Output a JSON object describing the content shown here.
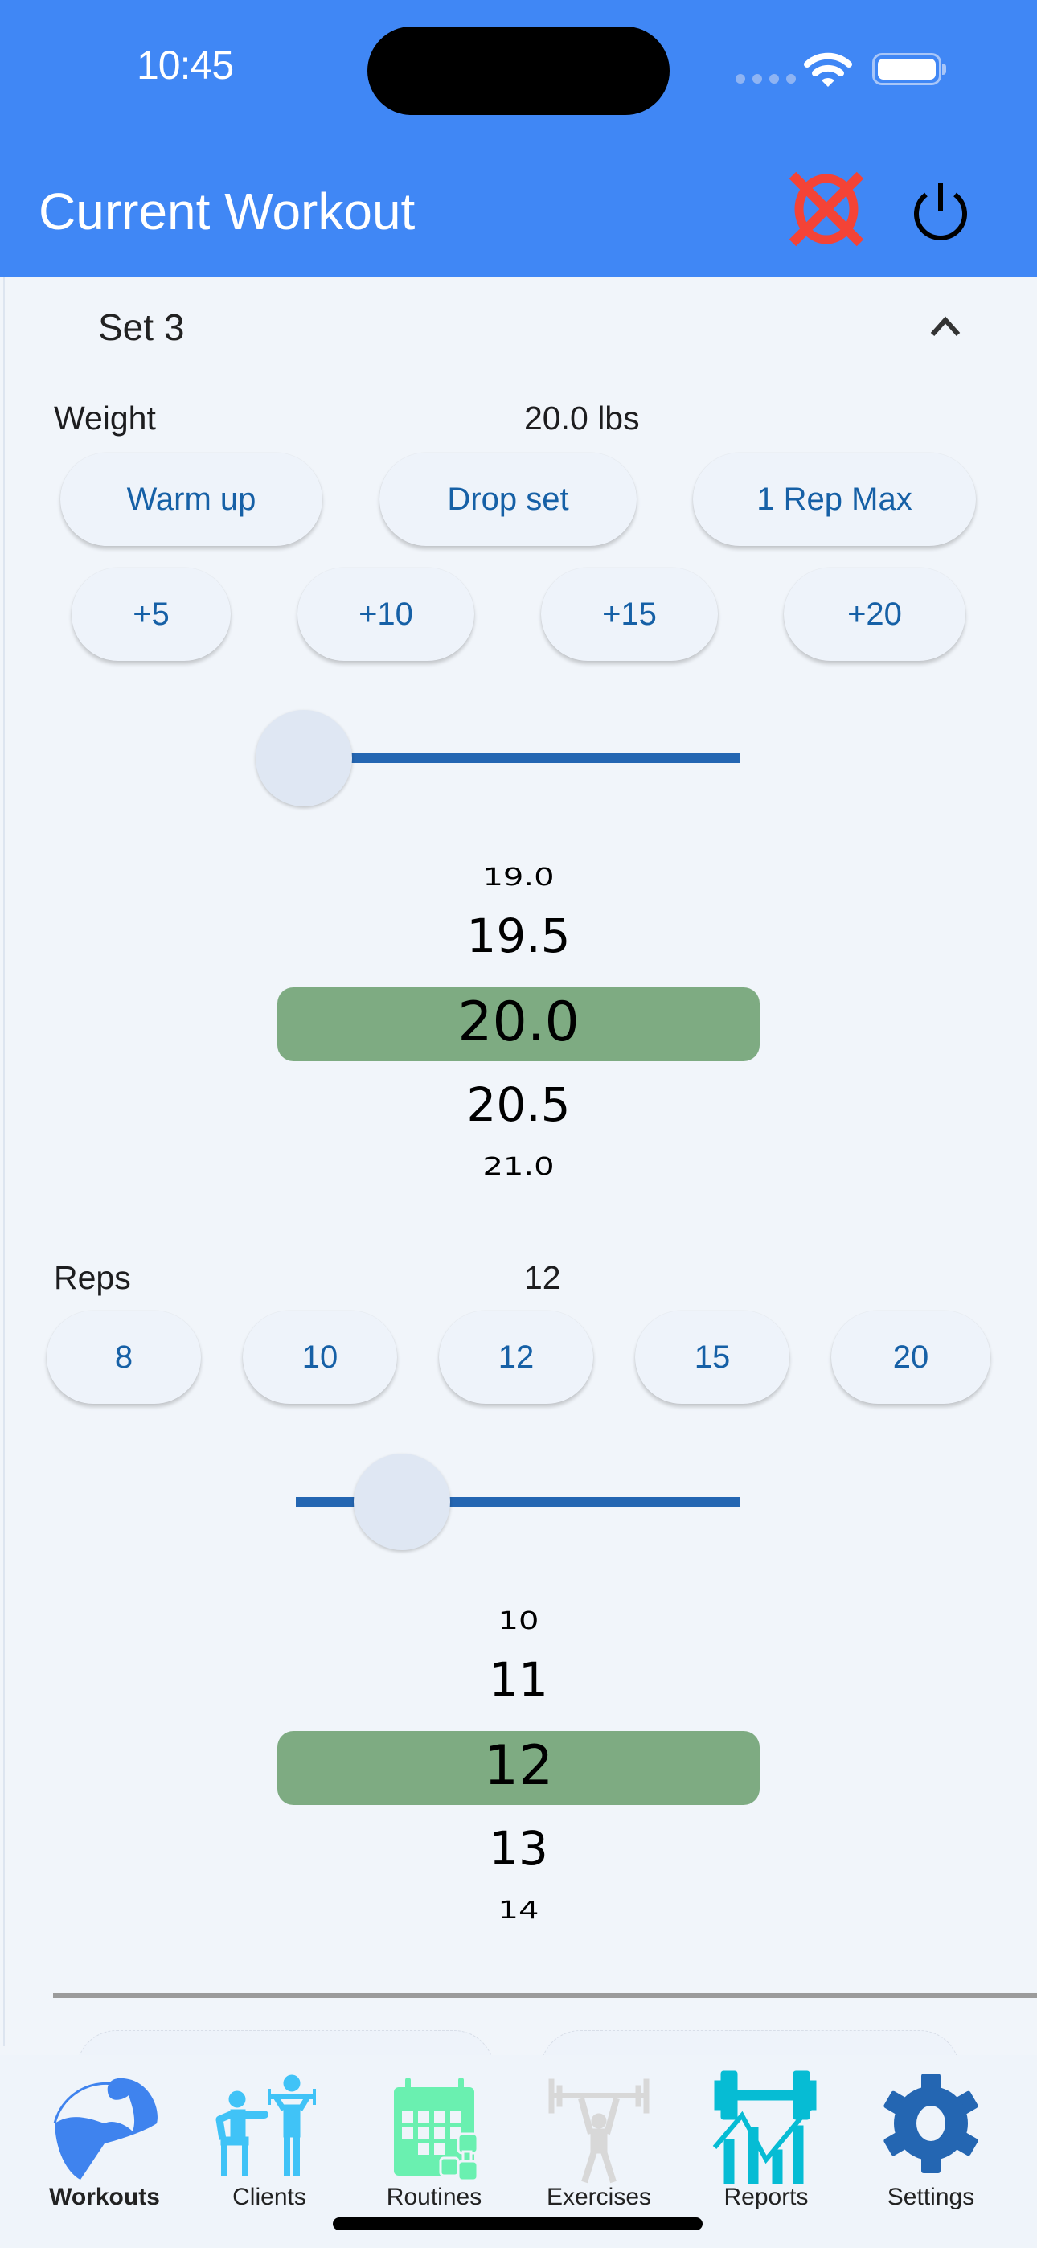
{
  "status_bar": {
    "time": "10:45"
  },
  "header": {
    "title": "Current Workout",
    "cancel_icon": "cancel-workout-icon",
    "power_icon": "power-icon",
    "accent_color": "#4087f5"
  },
  "set": {
    "title": "Set 3",
    "expanded": true,
    "weight": {
      "label": "Weight",
      "value_text": "20.0 lbs",
      "presets": [
        "Warm up",
        "Drop set",
        "1 Rep Max"
      ],
      "increments": [
        "+5",
        "+10",
        "+15",
        "+20"
      ],
      "slider_fraction": 0.0,
      "picker": {
        "items": [
          "19.0",
          "19.5",
          "20.0",
          "20.5",
          "21.0"
        ],
        "selected": "20.0",
        "selected_color": "#7eab82"
      }
    },
    "reps": {
      "label": "Reps",
      "value_text": "12",
      "presets": [
        "8",
        "10",
        "12",
        "15",
        "20"
      ],
      "slider_fraction": 0.24,
      "picker": {
        "items": [
          "10",
          "11",
          "12",
          "13",
          "14"
        ],
        "selected": "12",
        "selected_color": "#7eab82"
      }
    }
  },
  "tabbar": {
    "active": "Workouts",
    "items": [
      {
        "label": "Workouts",
        "icon": "flexed-bicep-icon",
        "color": "#3f83ee"
      },
      {
        "label": "Clients",
        "icon": "trainer-client-icon",
        "color": "#40c3f7"
      },
      {
        "label": "Routines",
        "icon": "calendar-dumbbell-icon",
        "color": "#6af0b0"
      },
      {
        "label": "Exercises",
        "icon": "weightlifter-icon",
        "color": "#d8d8d8"
      },
      {
        "label": "Reports",
        "icon": "dumbbell-chart-icon",
        "color": "#06bcd4"
      },
      {
        "label": "Settings",
        "icon": "gear-icon",
        "color": "#2466b2"
      }
    ]
  }
}
